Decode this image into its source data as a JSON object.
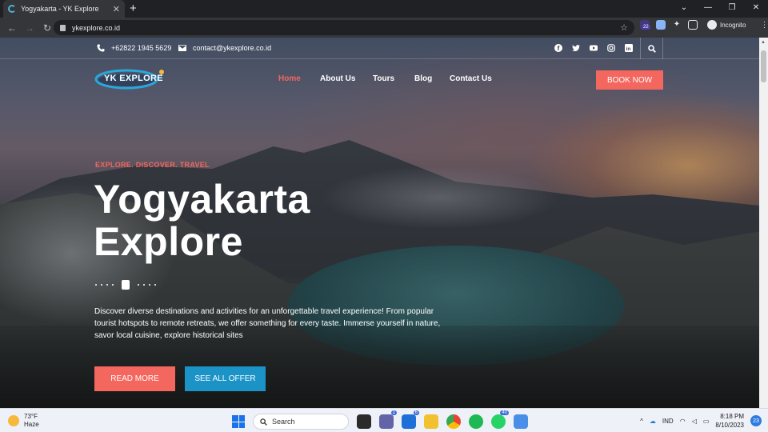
{
  "browser": {
    "tab_title": "Yogyakarta - YK Explore",
    "new_tab": "+",
    "url": "ykexplore.co.id",
    "profile_label": "Incognito",
    "extension_badge": "22",
    "window_controls": [
      "⌄",
      "—",
      "❐",
      "✕"
    ]
  },
  "topbar": {
    "phone": "+62822 1945 5629",
    "email": "contact@ykexplore.co.id",
    "social": [
      "facebook-icon",
      "twitter-icon",
      "youtube-icon",
      "instagram-icon",
      "linkedin-icon"
    ]
  },
  "logo": {
    "text": "YK EXPLORE"
  },
  "nav": {
    "items": [
      {
        "label": "Home",
        "active": true
      },
      {
        "label": "About Us",
        "active": false
      },
      {
        "label": "Tours",
        "active": false
      },
      {
        "label": "Blog",
        "active": false
      },
      {
        "label": "Contact Us",
        "active": false
      }
    ],
    "cta": "BOOK NOW"
  },
  "hero": {
    "kicker": "EXPLORE. DISCOVER. TRAVEL",
    "title_line1": "Yogyakarta",
    "title_line2": "Explore",
    "description": "Discover diverse destinations and activities for an unforgettable travel experience! From popular tourist hotspots to remote retreats, we offer something for every taste. Immerse yourself in nature, savor local cuisine, explore historical sites",
    "btn_primary": "READ MORE",
    "btn_secondary": "SEE ALL OFFER"
  },
  "colors": {
    "accent": "#f3675f",
    "blue": "#1b93c6"
  },
  "taskbar": {
    "weather_temp": "73°F",
    "weather_desc": "Haze",
    "search": "Search",
    "badges": {
      "teams": "1",
      "mail": "6",
      "whatsapp": "40"
    },
    "lang": "IND",
    "time": "8:18 PM",
    "date": "8/10/2023",
    "notifications": "23"
  }
}
